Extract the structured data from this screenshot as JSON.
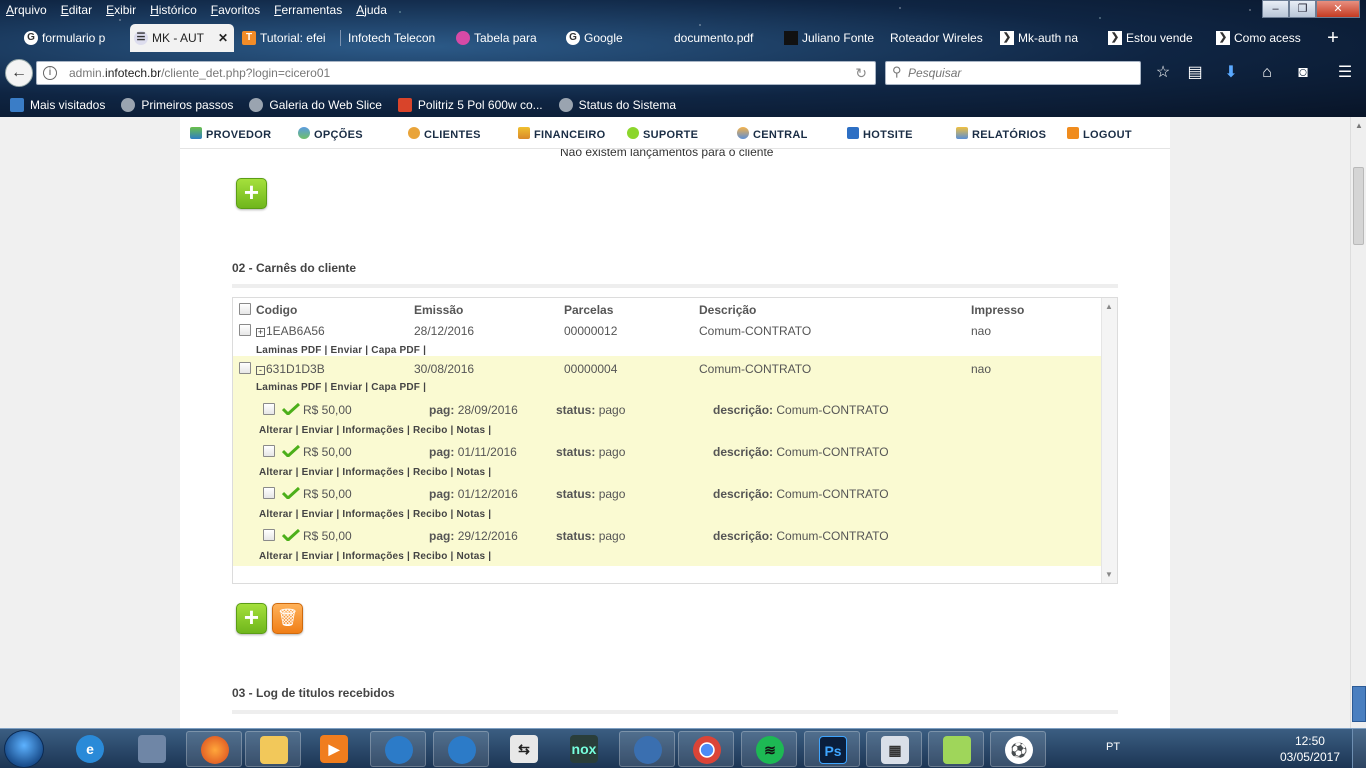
{
  "browser": {
    "menu": [
      "Arquivo",
      "Editar",
      "Exibir",
      "Histórico",
      "Favoritos",
      "Ferramentas",
      "Ajuda"
    ],
    "tabs": [
      {
        "label": "formulario p",
        "icon": "google-icon"
      },
      {
        "label": "MK - AUT",
        "icon": "mk-auth-icon",
        "active": true
      },
      {
        "label": "Tutorial: efei",
        "icon": "tutorial-icon"
      },
      {
        "label": "Infotech Telecon",
        "icon": "page-icon"
      },
      {
        "label": "Tabela para",
        "icon": "tabela-icon"
      },
      {
        "label": "Google",
        "icon": "google-icon"
      },
      {
        "label": "documento.pdf",
        "icon": "pdf-icon"
      },
      {
        "label": "Juliano Fonte",
        "icon": "page-icon"
      },
      {
        "label": "Roteador Wireles",
        "icon": "page-icon"
      },
      {
        "label": "Mk-auth na",
        "icon": "mk-auth-icon"
      },
      {
        "label": "Estou vende",
        "icon": "mk-auth-icon"
      },
      {
        "label": "Como acess",
        "icon": "mk-auth-icon"
      }
    ],
    "url_prefix": "admin.",
    "url_domain": "infotech.br",
    "url_path": "/cliente_det.php?login=cicero01",
    "search_placeholder": "Pesquisar",
    "bookmarks": [
      "Mais visitados",
      "Primeiros passos",
      "Galeria do Web Slice",
      "Politriz 5 Pol 600w co...",
      "Status do Sistema"
    ]
  },
  "topmenu": [
    "PROVEDOR",
    "OPÇÕES",
    "CLIENTES",
    "FINANCEIRO",
    "SUPORTE",
    "CENTRAL",
    "HOTSITE",
    "RELATÓRIOS",
    "LOGOUT"
  ],
  "lancamentos_empty": "Não existem lançamentos para o cliente",
  "section2": {
    "title": "02 - Carnês do cliente",
    "headers": [
      "Codigo",
      "Emissão",
      "Parcelas",
      "Descrição",
      "Impresso"
    ],
    "carnes": [
      {
        "expander": "+",
        "codigo": "1EAB6A56",
        "emissao": "28/12/2016",
        "parcelas": "00000012",
        "descricao": "Comum-CONTRATO",
        "impresso": "nao"
      },
      {
        "expander": "-",
        "codigo": "631D1D3B",
        "emissao": "30/08/2016",
        "parcelas": "00000004",
        "descricao": "Comum-CONTRATO",
        "impresso": "nao"
      }
    ],
    "carne_links": [
      "Laminas PDF",
      "Enviar",
      "Capa PDF"
    ],
    "titulos": [
      {
        "valor": "R$ 50,00",
        "pag": "28/09/2016",
        "status": "pago",
        "descricao": "Comum-CONTRATO"
      },
      {
        "valor": "R$ 50,00",
        "pag": "01/11/2016",
        "status": "pago",
        "descricao": "Comum-CONTRATO"
      },
      {
        "valor": "R$ 50,00",
        "pag": "01/12/2016",
        "status": "pago",
        "descricao": "Comum-CONTRATO"
      },
      {
        "valor": "R$ 50,00",
        "pag": "29/12/2016",
        "status": "pago",
        "descricao": "Comum-CONTRATO"
      }
    ],
    "titulo_labels": {
      "pag": "pag:",
      "status": "status:",
      "descricao": "descrição:"
    },
    "titulo_links": [
      "Alterar",
      "Enviar",
      "Informações",
      "Recibo",
      "Notas"
    ]
  },
  "section3": {
    "title": "03 - Log de titulos recebidos"
  },
  "taskbar": {
    "lang": "PT",
    "time": "12:50",
    "date": "03/05/2017"
  },
  "colors": {
    "expanded_bg": "#fafad2",
    "add_button": "#7cc524",
    "delete_button": "#f58a20",
    "check": "#4caf1a"
  }
}
